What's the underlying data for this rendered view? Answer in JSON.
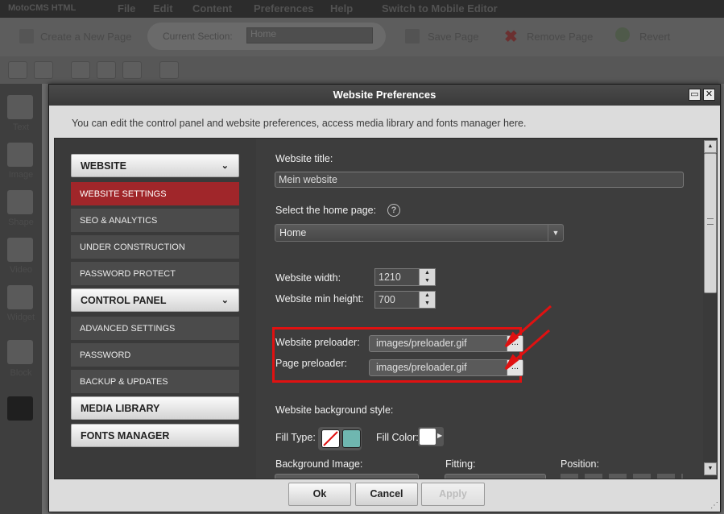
{
  "app": {
    "logo": "MotoCMS HTML",
    "menu": [
      "File",
      "Edit",
      "Content",
      "Preferences",
      "Help",
      "Switch to Mobile Editor"
    ],
    "toolbar": {
      "create_page": "Create a New Page",
      "current_section_label": "Current Section:",
      "current_section_value": "Home",
      "save_page": "Save Page",
      "remove_page": "Remove Page",
      "revert": "Revert"
    },
    "tools": [
      "Text",
      "Image",
      "Shape",
      "Video",
      "Widget",
      "Block"
    ]
  },
  "dialog": {
    "title": "Website Preferences",
    "intro": "You can edit the control panel and website preferences, access media library and fonts manager here.",
    "nav": {
      "website": "WEBSITE",
      "website_items": [
        "WEBSITE SETTINGS",
        "SEO & ANALYTICS",
        "UNDER CONSTRUCTION",
        "PASSWORD PROTECT"
      ],
      "control_panel": "CONTROL PANEL",
      "control_panel_items": [
        "ADVANCED SETTINGS",
        "PASSWORD",
        "BACKUP & UPDATES"
      ],
      "media_library": "MEDIA LIBRARY",
      "fonts_manager": "FONTS MANAGER"
    },
    "settings": {
      "website_title_label": "Website title:",
      "website_title_value": "Mein website",
      "home_page_label": "Select the home page:",
      "home_page_value": "Home",
      "width_label": "Website width:",
      "width_value": "1210",
      "min_height_label": "Website min height:",
      "min_height_value": "700",
      "website_preloader_label": "Website preloader:",
      "website_preloader_value": "images/preloader.gif",
      "page_preloader_label": "Page preloader:",
      "page_preloader_value": "images/preloader.gif",
      "bg_style_label": "Website background style:",
      "fill_type_label": "Fill Type:",
      "fill_color_label": "Fill Color:",
      "bg_image_label": "Background Image:",
      "fitting_label": "Fitting:",
      "position_label": "Position:",
      "browse_glyph": "..."
    },
    "buttons": {
      "ok": "Ok",
      "cancel": "Cancel",
      "apply": "Apply"
    },
    "colors": {
      "accent": "#a0262a",
      "highlight": "#e01111",
      "swatch_teal": "#6fb7b0"
    }
  }
}
